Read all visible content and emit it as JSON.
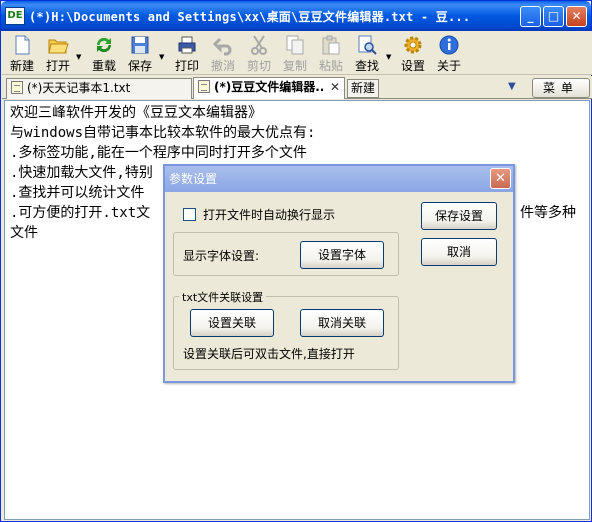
{
  "window": {
    "title": "(*)H:\\Documents and Settings\\xx\\桌面\\豆豆文件编辑器.txt - 豆...",
    "app_icon_text": "DE",
    "minimize": "_",
    "maximize": "□",
    "close": "✕"
  },
  "toolbar": {
    "new": "新建",
    "open": "打开",
    "reload": "重载",
    "save": "保存",
    "print": "打印",
    "undo": "撤消",
    "cut": "剪切",
    "copy": "复制",
    "paste": "粘贴",
    "find": "查找",
    "settings": "设置",
    "about": "关于"
  },
  "tabs": [
    {
      "label": "(*)天天记事本1.txt"
    },
    {
      "label": "(*)豆豆文件编辑器..",
      "close": "✕"
    }
  ],
  "tabbar": {
    "new_tab": "新建",
    "menu": "菜单",
    "dropdown": "▼"
  },
  "editor": {
    "lines": [
      "欢迎三峰软件开发的《豆豆文本编辑器》",
      "与windows自带记事本比较本软件的最大优点有:",
      ".多标签功能,能在一个程序中同时打开多个文件",
      ".快速加载大文件,特别",
      ".查找并可以统计文件",
      ".可方便的打开.txt文",
      "文件"
    ],
    "line6_tail": "件等多种"
  },
  "dialog": {
    "title": "参数设置",
    "close": "✕",
    "wrap_checkbox_label": "打开文件时自动换行显示",
    "wrap_checked": false,
    "font_label": "显示字体设置:",
    "font_button": "设置字体",
    "assoc_group_label": "txt文件关联设置",
    "assoc_button": "设置关联",
    "unassoc_button": "取消关联",
    "assoc_hint": "设置关联后可双击文件,直接打开",
    "save_button": "保存设置",
    "cancel_button": "取消"
  }
}
